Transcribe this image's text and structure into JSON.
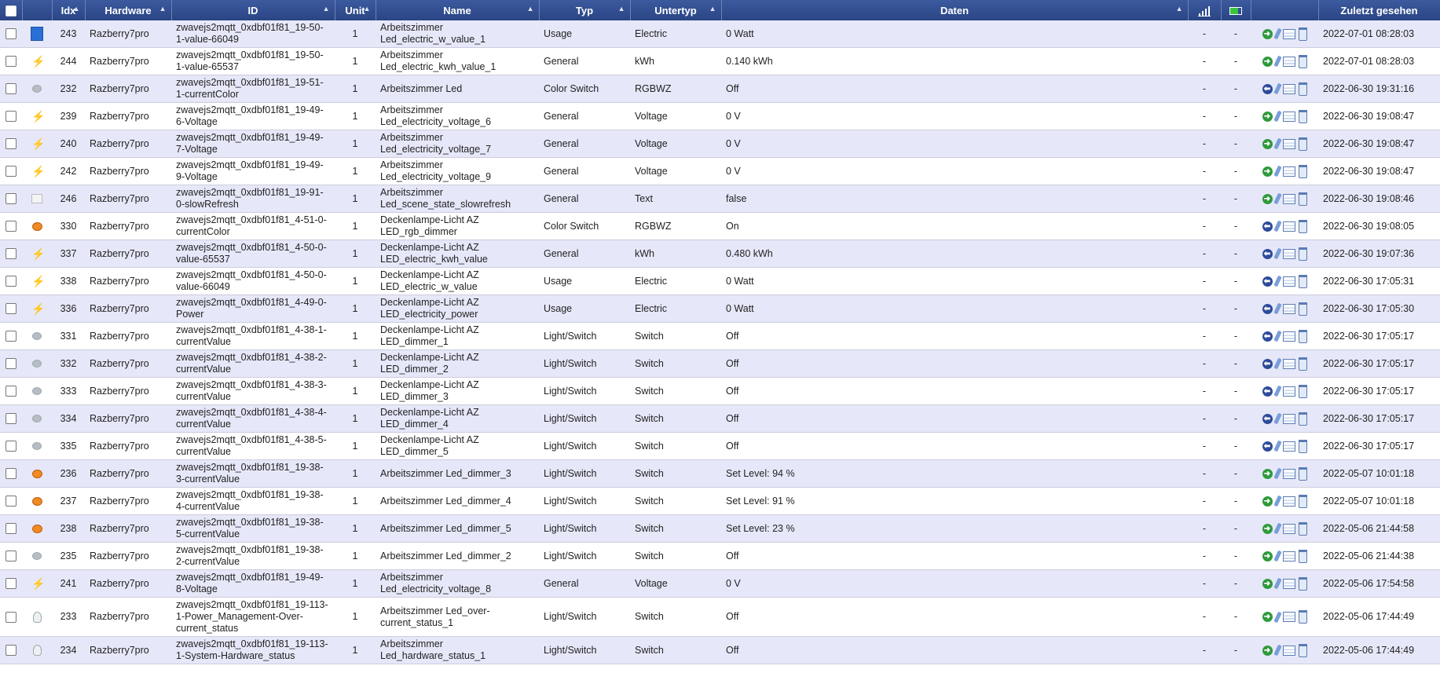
{
  "headers": {
    "idx": "Idx",
    "hardware": "Hardware",
    "id": "ID",
    "unit": "Unit",
    "name": "Name",
    "typ": "Typ",
    "untertyp": "Untertyp",
    "daten": "Daten",
    "zuletzt": "Zuletzt gesehen"
  },
  "colors": {
    "header": "#2a4585",
    "row_odd": "#e6e8f9",
    "row_even": "#ffffff"
  },
  "rows": [
    {
      "idx": "243",
      "hardware": "Razberry7pro",
      "id": "zwavejs2mqtt_0xdbf01f81_19-50-1-value-66049",
      "unit": "1",
      "name": "Arbeitszimmer Led_electric_w_value_1",
      "typ": "Usage",
      "untertyp": "Electric",
      "daten": "0 Watt",
      "sig": "-",
      "bat": "-",
      "last": "2022-07-01 08:28:03",
      "icon": "blue-square-icon",
      "action": "green"
    },
    {
      "idx": "244",
      "hardware": "Razberry7pro",
      "id": "zwavejs2mqtt_0xdbf01f81_19-50-1-value-65537",
      "unit": "1",
      "name": "Arbeitszimmer Led_electric_kwh_value_1",
      "typ": "General",
      "untertyp": "kWh",
      "daten": "0.140 kWh",
      "sig": "-",
      "bat": "-",
      "last": "2022-07-01 08:28:03",
      "icon": "bolt-icon",
      "action": "green"
    },
    {
      "idx": "232",
      "hardware": "Razberry7pro",
      "id": "zwavejs2mqtt_0xdbf01f81_19-51-1-currentColor",
      "unit": "1",
      "name": "Arbeitszimmer Led",
      "typ": "Color Switch",
      "untertyp": "RGBWZ",
      "daten": "Off",
      "sig": "-",
      "bat": "-",
      "last": "2022-06-30 19:31:16",
      "icon": "lamp-off-icon",
      "action": "blue"
    },
    {
      "idx": "239",
      "hardware": "Razberry7pro",
      "id": "zwavejs2mqtt_0xdbf01f81_19-49-6-Voltage",
      "unit": "1",
      "name": "Arbeitszimmer Led_electricity_voltage_6",
      "typ": "General",
      "untertyp": "Voltage",
      "daten": "0 V",
      "sig": "-",
      "bat": "-",
      "last": "2022-06-30 19:08:47",
      "icon": "bolt-icon",
      "action": "green"
    },
    {
      "idx": "240",
      "hardware": "Razberry7pro",
      "id": "zwavejs2mqtt_0xdbf01f81_19-49-7-Voltage",
      "unit": "1",
      "name": "Arbeitszimmer Led_electricity_voltage_7",
      "typ": "General",
      "untertyp": "Voltage",
      "daten": "0 V",
      "sig": "-",
      "bat": "-",
      "last": "2022-06-30 19:08:47",
      "icon": "bolt-icon",
      "action": "green"
    },
    {
      "idx": "242",
      "hardware": "Razberry7pro",
      "id": "zwavejs2mqtt_0xdbf01f81_19-49-9-Voltage",
      "unit": "1",
      "name": "Arbeitszimmer Led_electricity_voltage_9",
      "typ": "General",
      "untertyp": "Voltage",
      "daten": "0 V",
      "sig": "-",
      "bat": "-",
      "last": "2022-06-30 19:08:47",
      "icon": "bolt-icon",
      "action": "green"
    },
    {
      "idx": "246",
      "hardware": "Razberry7pro",
      "id": "zwavejs2mqtt_0xdbf01f81_19-91-0-slowRefresh",
      "unit": "1",
      "name": "Arbeitszimmer Led_scene_state_slowrefresh",
      "typ": "General",
      "untertyp": "Text",
      "daten": "false",
      "sig": "-",
      "bat": "-",
      "last": "2022-06-30 19:08:46",
      "icon": "text-icon",
      "action": "green"
    },
    {
      "idx": "330",
      "hardware": "Razberry7pro",
      "id": "zwavejs2mqtt_0xdbf01f81_4-51-0-currentColor",
      "unit": "1",
      "name": "Deckenlampe-Licht AZ LED_rgb_dimmer",
      "typ": "Color Switch",
      "untertyp": "RGBWZ",
      "daten": "On",
      "sig": "-",
      "bat": "-",
      "last": "2022-06-30 19:08:05",
      "icon": "lamp-on-icon",
      "action": "blue"
    },
    {
      "idx": "337",
      "hardware": "Razberry7pro",
      "id": "zwavejs2mqtt_0xdbf01f81_4-50-0-value-65537",
      "unit": "1",
      "name": "Deckenlampe-Licht AZ LED_electric_kwh_value",
      "typ": "General",
      "untertyp": "kWh",
      "daten": "0.480 kWh",
      "sig": "-",
      "bat": "-",
      "last": "2022-06-30 19:07:36",
      "icon": "bolt-icon",
      "action": "blue"
    },
    {
      "idx": "338",
      "hardware": "Razberry7pro",
      "id": "zwavejs2mqtt_0xdbf01f81_4-50-0-value-66049",
      "unit": "1",
      "name": "Deckenlampe-Licht AZ LED_electric_w_value",
      "typ": "Usage",
      "untertyp": "Electric",
      "daten": "0 Watt",
      "sig": "-",
      "bat": "-",
      "last": "2022-06-30 17:05:31",
      "icon": "bolt-icon",
      "action": "blue"
    },
    {
      "idx": "336",
      "hardware": "Razberry7pro",
      "id": "zwavejs2mqtt_0xdbf01f81_4-49-0-Power",
      "unit": "1",
      "name": "Deckenlampe-Licht AZ LED_electricity_power",
      "typ": "Usage",
      "untertyp": "Electric",
      "daten": "0 Watt",
      "sig": "-",
      "bat": "-",
      "last": "2022-06-30 17:05:30",
      "icon": "bolt-icon",
      "action": "blue"
    },
    {
      "idx": "331",
      "hardware": "Razberry7pro",
      "id": "zwavejs2mqtt_0xdbf01f81_4-38-1-currentValue",
      "unit": "1",
      "name": "Deckenlampe-Licht AZ LED_dimmer_1",
      "typ": "Light/Switch",
      "untertyp": "Switch",
      "daten": "Off",
      "sig": "-",
      "bat": "-",
      "last": "2022-06-30 17:05:17",
      "icon": "lamp-off-icon",
      "action": "blue"
    },
    {
      "idx": "332",
      "hardware": "Razberry7pro",
      "id": "zwavejs2mqtt_0xdbf01f81_4-38-2-currentValue",
      "unit": "1",
      "name": "Deckenlampe-Licht AZ LED_dimmer_2",
      "typ": "Light/Switch",
      "untertyp": "Switch",
      "daten": "Off",
      "sig": "-",
      "bat": "-",
      "last": "2022-06-30 17:05:17",
      "icon": "lamp-off-icon",
      "action": "blue"
    },
    {
      "idx": "333",
      "hardware": "Razberry7pro",
      "id": "zwavejs2mqtt_0xdbf01f81_4-38-3-currentValue",
      "unit": "1",
      "name": "Deckenlampe-Licht AZ LED_dimmer_3",
      "typ": "Light/Switch",
      "untertyp": "Switch",
      "daten": "Off",
      "sig": "-",
      "bat": "-",
      "last": "2022-06-30 17:05:17",
      "icon": "lamp-off-icon",
      "action": "blue"
    },
    {
      "idx": "334",
      "hardware": "Razberry7pro",
      "id": "zwavejs2mqtt_0xdbf01f81_4-38-4-currentValue",
      "unit": "1",
      "name": "Deckenlampe-Licht AZ LED_dimmer_4",
      "typ": "Light/Switch",
      "untertyp": "Switch",
      "daten": "Off",
      "sig": "-",
      "bat": "-",
      "last": "2022-06-30 17:05:17",
      "icon": "lamp-off-icon",
      "action": "blue"
    },
    {
      "idx": "335",
      "hardware": "Razberry7pro",
      "id": "zwavejs2mqtt_0xdbf01f81_4-38-5-currentValue",
      "unit": "1",
      "name": "Deckenlampe-Licht AZ LED_dimmer_5",
      "typ": "Light/Switch",
      "untertyp": "Switch",
      "daten": "Off",
      "sig": "-",
      "bat": "-",
      "last": "2022-06-30 17:05:17",
      "icon": "lamp-off-icon",
      "action": "blue"
    },
    {
      "idx": "236",
      "hardware": "Razberry7pro",
      "id": "zwavejs2mqtt_0xdbf01f81_19-38-3-currentValue",
      "unit": "1",
      "name": "Arbeitszimmer Led_dimmer_3",
      "typ": "Light/Switch",
      "untertyp": "Switch",
      "daten": "Set Level: 94 %",
      "sig": "-",
      "bat": "-",
      "last": "2022-05-07 10:01:18",
      "icon": "lamp-on-icon",
      "action": "green"
    },
    {
      "idx": "237",
      "hardware": "Razberry7pro",
      "id": "zwavejs2mqtt_0xdbf01f81_19-38-4-currentValue",
      "unit": "1",
      "name": "Arbeitszimmer Led_dimmer_4",
      "typ": "Light/Switch",
      "untertyp": "Switch",
      "daten": "Set Level: 91 %",
      "sig": "-",
      "bat": "-",
      "last": "2022-05-07 10:01:18",
      "icon": "lamp-on-icon",
      "action": "green"
    },
    {
      "idx": "238",
      "hardware": "Razberry7pro",
      "id": "zwavejs2mqtt_0xdbf01f81_19-38-5-currentValue",
      "unit": "1",
      "name": "Arbeitszimmer Led_dimmer_5",
      "typ": "Light/Switch",
      "untertyp": "Switch",
      "daten": "Set Level: 23 %",
      "sig": "-",
      "bat": "-",
      "last": "2022-05-06 21:44:58",
      "icon": "lamp-on-icon",
      "action": "green"
    },
    {
      "idx": "235",
      "hardware": "Razberry7pro",
      "id": "zwavejs2mqtt_0xdbf01f81_19-38-2-currentValue",
      "unit": "1",
      "name": "Arbeitszimmer Led_dimmer_2",
      "typ": "Light/Switch",
      "untertyp": "Switch",
      "daten": "Off",
      "sig": "-",
      "bat": "-",
      "last": "2022-05-06 21:44:38",
      "icon": "lamp-off-icon",
      "action": "green"
    },
    {
      "idx": "241",
      "hardware": "Razberry7pro",
      "id": "zwavejs2mqtt_0xdbf01f81_19-49-8-Voltage",
      "unit": "1",
      "name": "Arbeitszimmer Led_electricity_voltage_8",
      "typ": "General",
      "untertyp": "Voltage",
      "daten": "0 V",
      "sig": "-",
      "bat": "-",
      "last": "2022-05-06 17:54:58",
      "icon": "bolt-icon",
      "action": "green"
    },
    {
      "idx": "233",
      "hardware": "Razberry7pro",
      "id": "zwavejs2mqtt_0xdbf01f81_19-113-1-Power_Management-Over-current_status",
      "unit": "1",
      "name": "Arbeitszimmer Led_over-current_status_1",
      "typ": "Light/Switch",
      "untertyp": "Switch",
      "daten": "Off",
      "sig": "-",
      "bat": "-",
      "last": "2022-05-06 17:44:49",
      "icon": "bulb-icon",
      "action": "green"
    },
    {
      "idx": "234",
      "hardware": "Razberry7pro",
      "id": "zwavejs2mqtt_0xdbf01f81_19-113-1-System-Hardware_status",
      "unit": "1",
      "name": "Arbeitszimmer Led_hardware_status_1",
      "typ": "Light/Switch",
      "untertyp": "Switch",
      "daten": "Off",
      "sig": "-",
      "bat": "-",
      "last": "2022-05-06 17:44:49",
      "icon": "bulb-icon",
      "action": "green"
    }
  ]
}
